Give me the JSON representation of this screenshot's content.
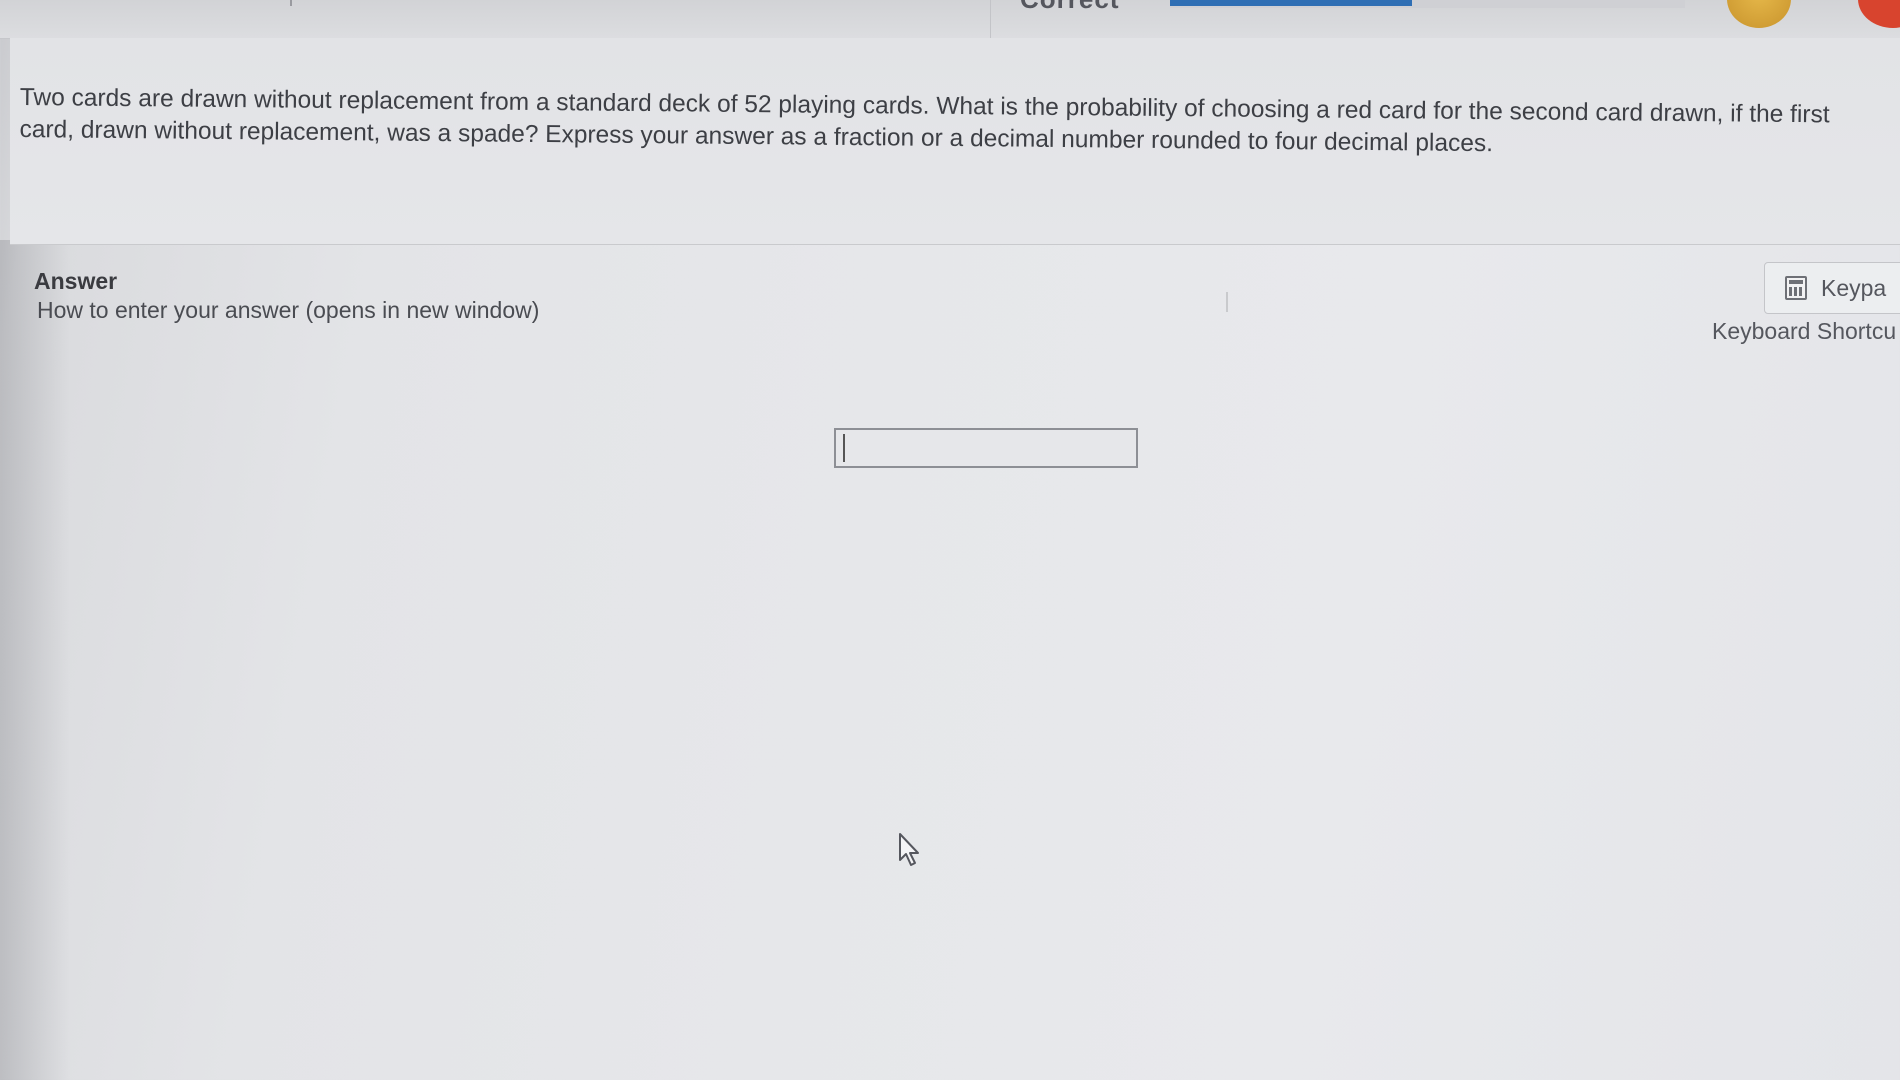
{
  "header": {
    "status_text": "Correct",
    "progress_fraction": 0.47
  },
  "question": {
    "text": "Two cards are drawn without replacement from a standard deck of 52 playing cards. What is the probability of choosing a red card for the second card drawn, if the first card, drawn without replacement, was a spade? Express your answer as a fraction or a decimal number rounded to four decimal places."
  },
  "answer": {
    "label": "Answer",
    "help_link": "How to enter your answer (opens in new window)",
    "input_value": "",
    "input_placeholder": ""
  },
  "tools": {
    "keypad_label": "Keypa",
    "shortcuts_label": "Keyboard Shortcu"
  },
  "icons": {
    "keypad": "calculator-icon",
    "cursor": "mouse-pointer-icon",
    "avatar": "avatar-icon",
    "close": "close-icon"
  },
  "colors": {
    "progress": "#2f6fb4",
    "close": "#d8442e",
    "avatar": "#d9a63c"
  }
}
